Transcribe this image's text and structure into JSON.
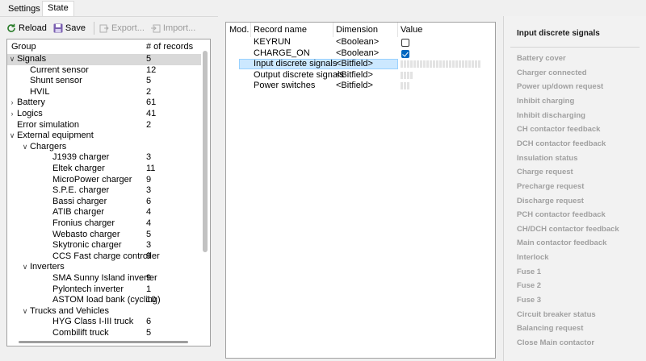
{
  "tabs": [
    {
      "label": "Settings",
      "active": false
    },
    {
      "label": "State",
      "active": true
    }
  ],
  "toolbar": {
    "reload": "Reload",
    "save": "Save",
    "export": "Export...",
    "import": "Import..."
  },
  "tree": {
    "col_group": "Group",
    "col_count": "# of records",
    "rows": [
      {
        "label": "Signals",
        "count": "5",
        "level": 0,
        "expanded": true,
        "selected": true
      },
      {
        "label": "Current sensor",
        "count": "12",
        "level": 1
      },
      {
        "label": "Shunt sensor",
        "count": "5",
        "level": 1
      },
      {
        "label": "HVIL",
        "count": "2",
        "level": 1
      },
      {
        "label": "Battery",
        "count": "61",
        "level": 0,
        "expanded": false
      },
      {
        "label": "Logics",
        "count": "41",
        "level": 0,
        "expanded": false
      },
      {
        "label": "Error simulation",
        "count": "2",
        "level": 0
      },
      {
        "label": "External equipment",
        "count": "",
        "level": 0,
        "expanded": true
      },
      {
        "label": "Chargers",
        "count": "",
        "level": 1,
        "expanded": true
      },
      {
        "label": "J1939 charger",
        "count": "3",
        "level": 2
      },
      {
        "label": "Eltek charger",
        "count": "11",
        "level": 2
      },
      {
        "label": "MicroPower charger",
        "count": "9",
        "level": 2
      },
      {
        "label": "S.P.E. charger",
        "count": "3",
        "level": 2
      },
      {
        "label": "Bassi charger",
        "count": "6",
        "level": 2
      },
      {
        "label": "ATIB charger",
        "count": "4",
        "level": 2
      },
      {
        "label": "Fronius charger",
        "count": "4",
        "level": 2
      },
      {
        "label": "Webasto charger",
        "count": "5",
        "level": 2
      },
      {
        "label": "Skytronic charger",
        "count": "3",
        "level": 2
      },
      {
        "label": "CCS Fast charge controller",
        "count": "9",
        "level": 2
      },
      {
        "label": "Inverters",
        "count": "",
        "level": 1,
        "expanded": true
      },
      {
        "label": "SMA Sunny Island inverter",
        "count": "9",
        "level": 2
      },
      {
        "label": "Pylontech inverter",
        "count": "1",
        "level": 2
      },
      {
        "label": "ASTOM load bank (cycling)",
        "count": "10",
        "level": 2
      },
      {
        "label": "Trucks and Vehicles",
        "count": "",
        "level": 1,
        "expanded": true
      },
      {
        "label": "HYG Class I-III truck",
        "count": "6",
        "level": 2
      },
      {
        "label": "Combilift truck",
        "count": "5",
        "level": 2
      }
    ]
  },
  "records": {
    "col_mod": "Mod.",
    "col_name": "Record name",
    "col_dimension": "Dimension",
    "col_value": "Value",
    "rows": [
      {
        "name": "KEYRUN",
        "dimension": "<Boolean>",
        "type": "bool",
        "checked": false
      },
      {
        "name": "CHARGE_ON",
        "dimension": "<Boolean>",
        "type": "bool",
        "checked": true
      },
      {
        "name": "Input discrete signals",
        "dimension": "<Bitfield>",
        "type": "bits",
        "bits": 25,
        "selected": true
      },
      {
        "name": "Output discrete signals",
        "dimension": "<Bitfield>",
        "type": "bits",
        "bits": 4
      },
      {
        "name": "Power switches",
        "dimension": "<Bitfield>",
        "type": "bits",
        "bits": 3
      }
    ]
  },
  "detail": {
    "title": "Input discrete signals",
    "items": [
      "Battery cover",
      "Charger connected",
      "Power up/down request",
      "Inhibit charging",
      "Inhibit discharging",
      "CH contactor feedback",
      "DCH contactor feedback",
      "Insulation status",
      "Charge request",
      "Precharge request",
      "Discharge request",
      "PCH contactor feedback",
      "CH/DCH contactor feedback",
      "Main contactor feedback",
      "Interlock",
      "Fuse 1",
      "Fuse 2",
      "Fuse 3",
      "Circuit breaker status",
      "Balancing request",
      "Close Main contactor"
    ]
  },
  "colors": {
    "selection_bg": "#cce8ff",
    "checkbox_on": "#0067c0"
  }
}
